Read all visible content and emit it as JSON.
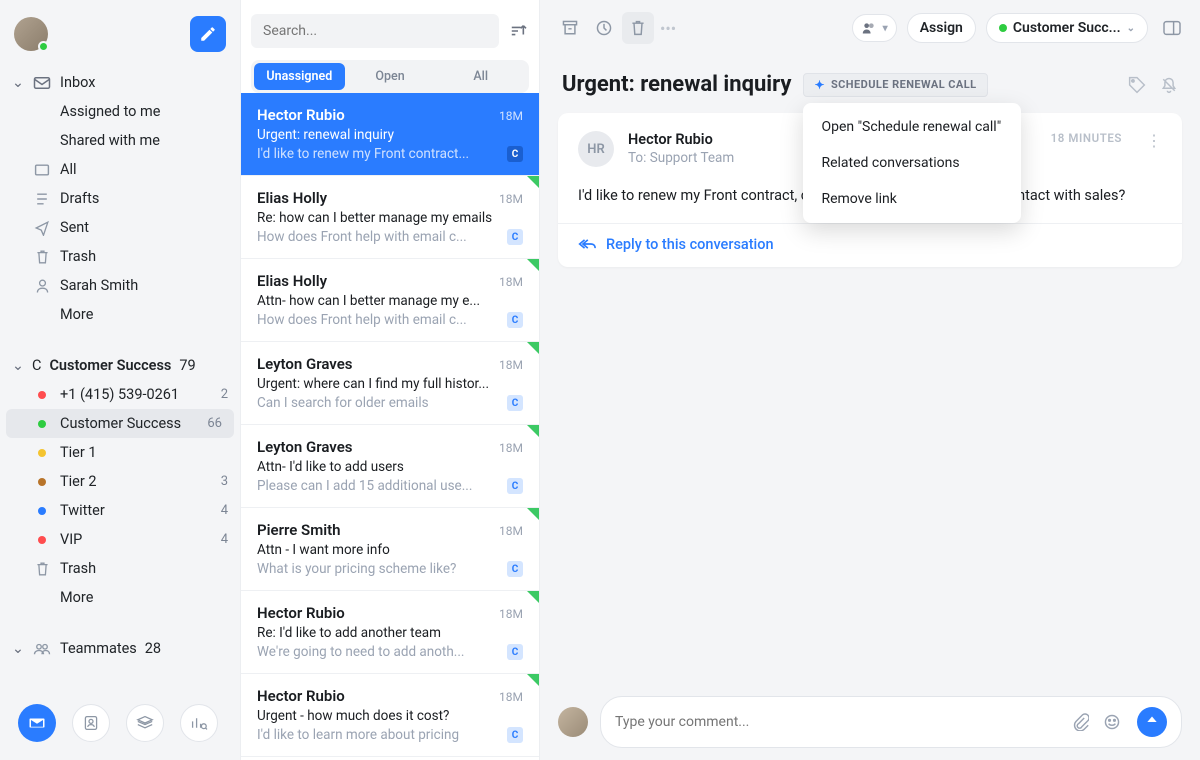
{
  "sidebar": {
    "inbox": {
      "label": "Inbox",
      "assigned": "Assigned to me",
      "shared": "Shared with me",
      "all": "All",
      "drafts": "Drafts",
      "sent": "Sent",
      "trash": "Trash",
      "user": "Sarah Smith",
      "more": "More"
    },
    "cs": {
      "label": "Customer Success",
      "count": "79",
      "items": [
        {
          "label": "+1 (415) 539-0261",
          "count": "2",
          "color": "#ff4d4f"
        },
        {
          "label": "Customer Success",
          "count": "66",
          "color": "#2ecc40"
        },
        {
          "label": "Tier 1",
          "count": "",
          "color": "#f4c430"
        },
        {
          "label": "Tier 2",
          "count": "3",
          "color": "#b8742a"
        },
        {
          "label": "Twitter",
          "count": "4",
          "color": "#2a7cff"
        },
        {
          "label": "VIP",
          "count": "4",
          "color": "#ff4d4f"
        }
      ],
      "trash": "Trash",
      "more": "More"
    },
    "teammates": {
      "label": "Teammates",
      "count": "28"
    }
  },
  "search": {
    "placeholder": "Search..."
  },
  "filters": {
    "unassigned": "Unassigned",
    "open": "Open",
    "all": "All"
  },
  "conversations": [
    {
      "sender": "Hector Rubio",
      "time": "18M",
      "subject": "Urgent: renewal inquiry",
      "preview": "I'd like to renew my Front contract...",
      "selected": true,
      "flag": false
    },
    {
      "sender": "Elias Holly",
      "time": "18M",
      "subject": "Re: how can I better manage my emails",
      "preview": "How does Front help with email c...",
      "flag": true
    },
    {
      "sender": "Elias Holly",
      "time": "18M",
      "subject": "Attn- how can I better manage my e...",
      "preview": "How does Front help with email c...",
      "flag": true
    },
    {
      "sender": "Leyton Graves",
      "time": "18M",
      "subject": "Urgent: where can I find my full histor...",
      "preview": "Can I search for older emails",
      "flag": true
    },
    {
      "sender": "Leyton Graves",
      "time": "18M",
      "subject": "Attn- I'd like to add users",
      "preview": "Please can I add 15 additional use...",
      "flag": true
    },
    {
      "sender": "Pierre Smith",
      "time": "18M",
      "subject": "Attn - I want more info",
      "preview": "What is your pricing scheme like?",
      "flag": true
    },
    {
      "sender": "Hector Rubio",
      "time": "18M",
      "subject": "Re: I'd like to add another team",
      "preview": "We're going to need to add anoth...",
      "flag": true
    },
    {
      "sender": "Hector Rubio",
      "time": "18M",
      "subject": "Urgent - how much does it cost?",
      "preview": "I'd like to learn more about pricing",
      "flag": true
    }
  ],
  "toolbar": {
    "assign": "Assign",
    "cs_pill": "Customer Succ..."
  },
  "message": {
    "subject": "Urgent: renewal inquiry",
    "chip_label": "SCHEDULE RENEWAL CALL",
    "from": "Hector Rubio",
    "from_initials": "HR",
    "to_prefix": "To:",
    "to": "Support Team",
    "time": "18 MINUTES",
    "body": "I'd like to renew my Front contract, can someone please put me in contact with sales?",
    "reply": "Reply to this conversation"
  },
  "dropdown": {
    "open": "Open \"Schedule renewal call\"",
    "related": "Related conversations",
    "remove": "Remove link"
  },
  "compose": {
    "placeholder": "Type your comment..."
  },
  "badge_letter": "C"
}
